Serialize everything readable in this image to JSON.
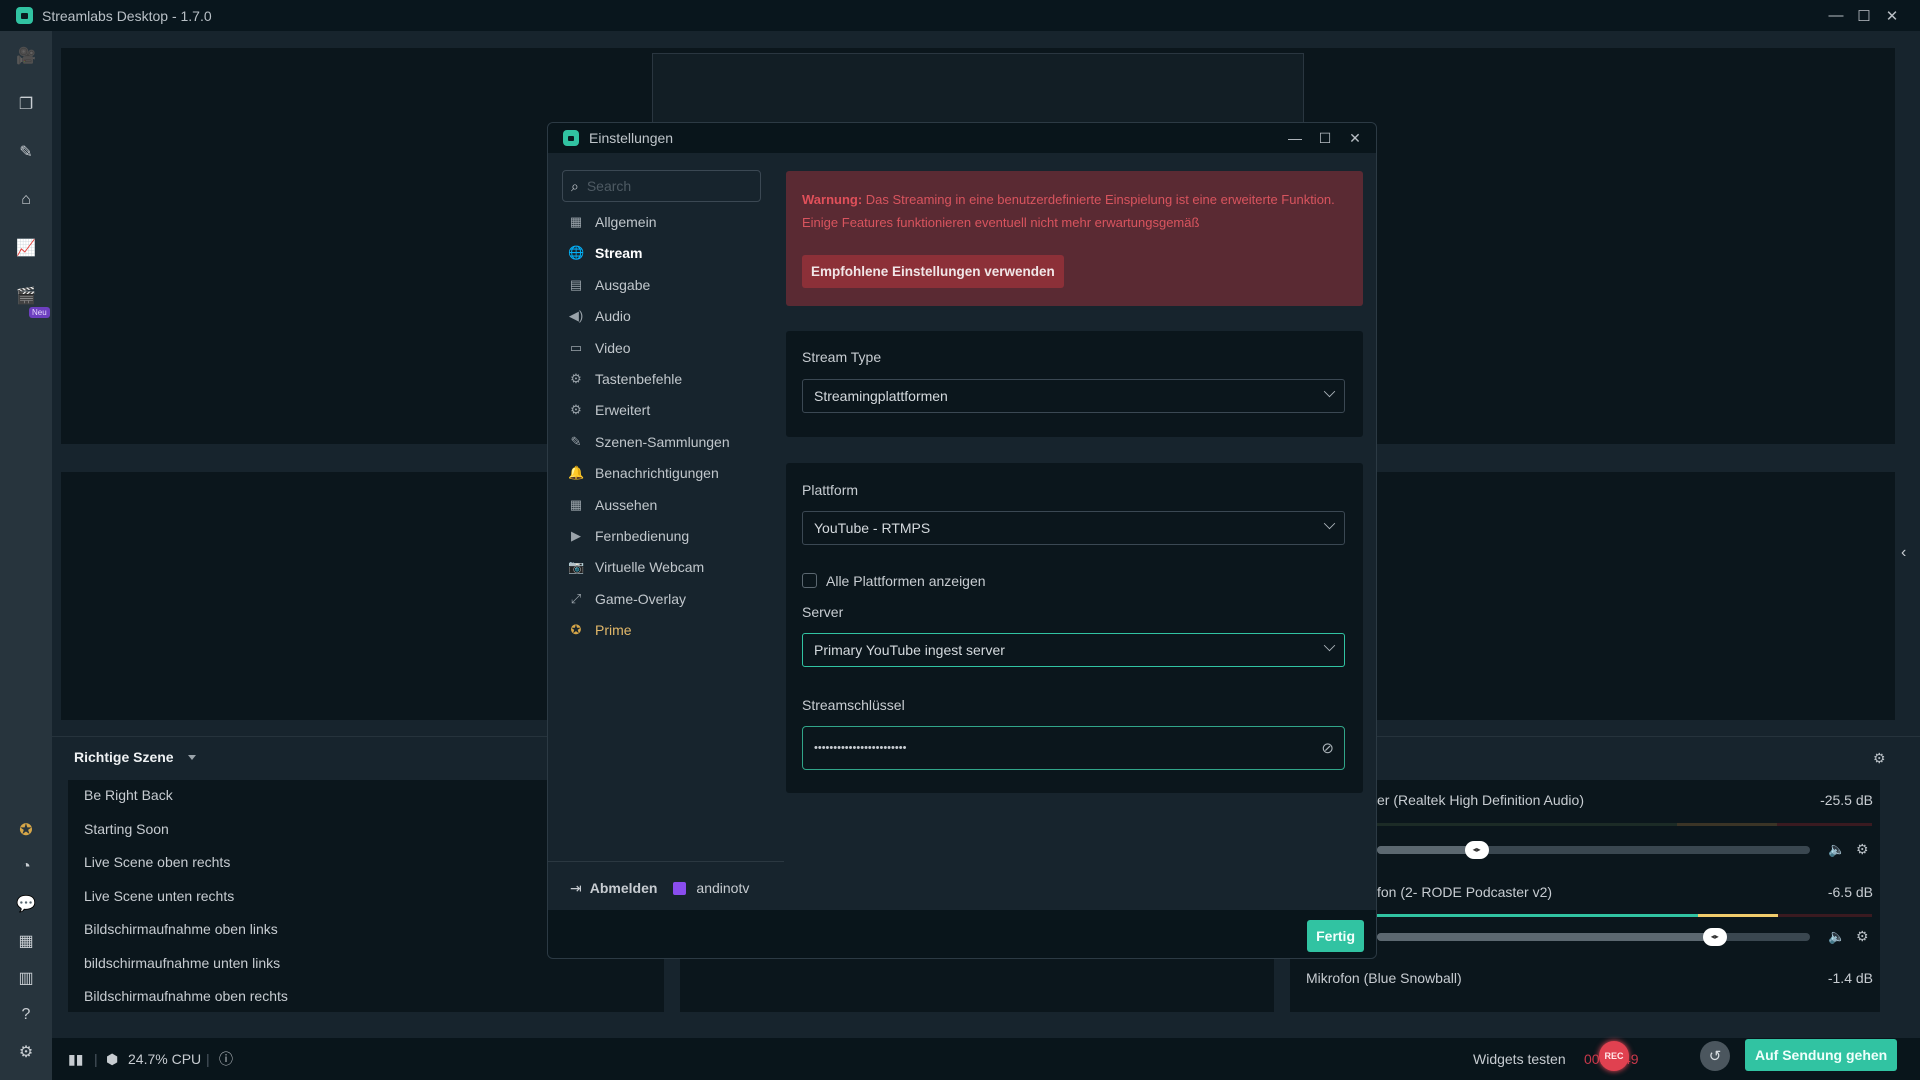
{
  "app": {
    "title": "Streamlabs Desktop - 1.7.0",
    "window_controls": {
      "minimize": "—",
      "maximize": "☐",
      "close": "✕"
    }
  },
  "left_nav": {
    "top_icons": [
      {
        "name": "editor-icon",
        "glyph": "🎥"
      },
      {
        "name": "themes-icon",
        "glyph": "❐"
      },
      {
        "name": "scene-collections-icon",
        "glyph": "✎"
      },
      {
        "name": "store-icon",
        "glyph": "⌂"
      },
      {
        "name": "dashboard-icon",
        "glyph": "📈"
      },
      {
        "name": "highlighter-icon",
        "glyph": "🎬"
      }
    ],
    "new_badge": "Neu",
    "bottom_icons": [
      {
        "name": "prime-icon",
        "glyph": "✪"
      },
      {
        "name": "dashboard-gauge-icon",
        "glyph": "◔"
      },
      {
        "name": "chat-icon",
        "glyph": "💬"
      },
      {
        "name": "layout-icon",
        "glyph": "▦"
      },
      {
        "name": "studio-mode-icon",
        "glyph": "▥"
      },
      {
        "name": "help-icon",
        "glyph": "?"
      },
      {
        "name": "settings-icon",
        "glyph": "⚙"
      }
    ]
  },
  "settings_dialog": {
    "title": "Einstellungen",
    "search_placeholder": "Search",
    "menu": [
      {
        "label": "Allgemein",
        "icon": "▦",
        "state": "normal"
      },
      {
        "label": "Stream",
        "icon": "🌐",
        "state": "active"
      },
      {
        "label": "Ausgabe",
        "icon": "▤",
        "state": "normal"
      },
      {
        "label": "Audio",
        "icon": "◀)",
        "state": "normal"
      },
      {
        "label": "Video",
        "icon": "▭",
        "state": "normal"
      },
      {
        "label": "Tastenbefehle",
        "icon": "⚙",
        "state": "normal"
      },
      {
        "label": "Erweitert",
        "icon": "⚙",
        "state": "normal"
      },
      {
        "label": "Szenen-Sammlungen",
        "icon": "✎",
        "state": "normal"
      },
      {
        "label": "Benachrichtigungen",
        "icon": "🔔",
        "state": "normal"
      },
      {
        "label": "Aussehen",
        "icon": "▦",
        "state": "normal"
      },
      {
        "label": "Fernbedienung",
        "icon": "▶",
        "state": "normal"
      },
      {
        "label": "Virtuelle Webcam",
        "icon": "📷",
        "state": "normal"
      },
      {
        "label": "Game-Overlay",
        "icon": "⤢",
        "state": "normal"
      },
      {
        "label": "Prime",
        "icon": "✪",
        "state": "prime"
      }
    ],
    "account": {
      "logout_label": "Abmelden",
      "username": "andinotv"
    },
    "warning": {
      "prefix": "Warnung:",
      "text": " Das Streaming in eine benutzerdefinierte Einspielung ist eine erweiterte Funktion. Einige Features funktionieren eventuell nicht mehr erwartungsgemäß",
      "button": "Empfohlene Einstellungen verwenden"
    },
    "stream_type": {
      "label": "Stream Type",
      "value": "Streamingplattformen"
    },
    "platform": {
      "label": "Plattform",
      "value": "YouTube - RTMPS"
    },
    "show_all_platforms": {
      "label": "Alle Plattformen anzeigen",
      "checked": false
    },
    "server": {
      "label": "Server",
      "value": "Primary YouTube ingest server"
    },
    "stream_key": {
      "label": "Streamschlüssel",
      "value": "••••••••••••••••••••••••"
    },
    "done_button": "Fertig"
  },
  "scenes": {
    "collection": "Richtige Szene",
    "items": [
      "Be Right Back",
      "Starting Soon",
      "Live Scene oben rechts",
      "Live Scene unten rechts",
      "Bildschirmaufnahme oben links",
      "bildschirmaufnahme unten links",
      "Bildschirmaufnahme oben rechts"
    ]
  },
  "mixer": {
    "sources": [
      {
        "name": "er (Realtek High Definition Audio)",
        "db": "-25.5 dB",
        "volume": 0.23,
        "level": 0.0
      },
      {
        "name": "fon (2- RODE Podcaster v2)",
        "db": "-6.5 dB",
        "volume": 0.78,
        "level": 0.88
      },
      {
        "name": "Mikrofon (Blue Snowball)",
        "db": "-1.4 dB"
      }
    ]
  },
  "footer": {
    "cpu": "24.7% CPU",
    "test_widgets": "Widgets testen",
    "rec_time": "00:03:49",
    "rec_label": "REC",
    "go_live": "Auf Sendung gehen"
  },
  "colors": {
    "accent": "#31c3a2",
    "warning_bg": "#5a2a33",
    "warning_text": "#d8545e",
    "rec": "#e04150",
    "prime": "#e2b86a",
    "twitch": "#8a4dee"
  }
}
